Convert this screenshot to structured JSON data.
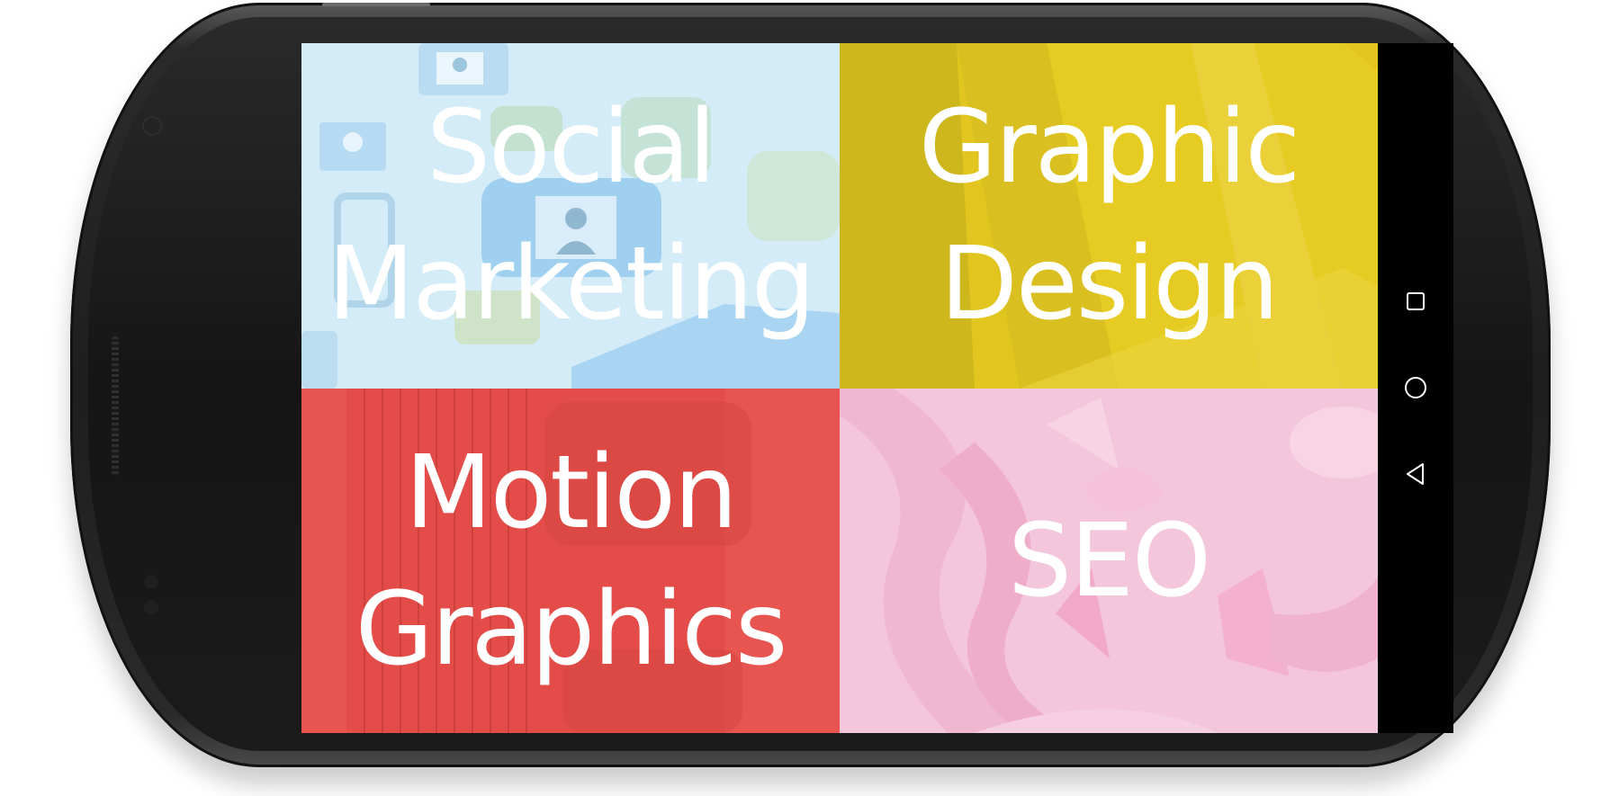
{
  "tiles": [
    {
      "id": "social-marketing",
      "label": "Social\nMarketing",
      "color": "#d4ebf8"
    },
    {
      "id": "graphic-design",
      "label": "Graphic\nDesign",
      "color": "#e2c51e"
    },
    {
      "id": "motion-graphics",
      "label": "Motion\nGraphics",
      "color": "#e85450"
    },
    {
      "id": "seo",
      "label": "SEO",
      "color": "#f4c6dc"
    }
  ],
  "navbar": {
    "buttons": [
      "recents-icon",
      "home-icon",
      "back-icon"
    ]
  },
  "colors": {
    "device_body": "#1e1e1e",
    "navbar": "#000000",
    "label_text": "#ffffff"
  }
}
